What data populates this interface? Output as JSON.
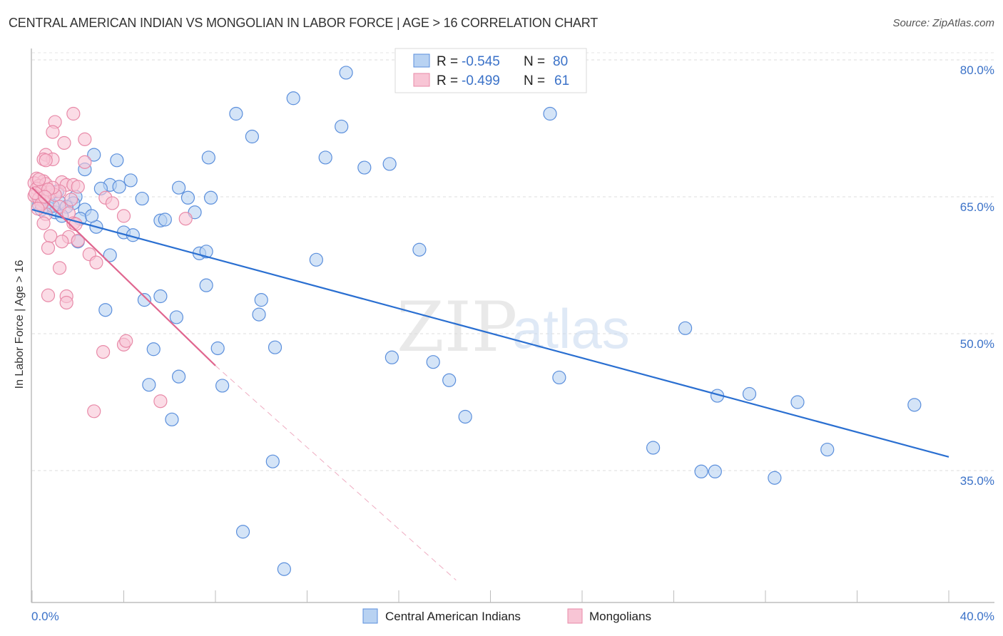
{
  "title": "CENTRAL AMERICAN INDIAN VS MONGOLIAN IN LABOR FORCE | AGE > 16 CORRELATION CHART",
  "source": "Source: ZipAtlas.com",
  "watermark": {
    "zip": "ZIP",
    "atlas": "atlas"
  },
  "colors": {
    "blue_fill": "#b8d2f2",
    "blue_stroke": "#5b8fdc",
    "blue_line": "#2a6fd1",
    "pink_fill": "#f8c5d5",
    "pink_stroke": "#e88aa8",
    "pink_line": "#e0668f",
    "tick": "#3b72c8"
  },
  "stats_legend": {
    "rows": [
      {
        "r_label": "R =",
        "r_value": "-0.545",
        "n_label": "N =",
        "n_value": "80"
      },
      {
        "r_label": "R =",
        "r_value": "-0.499",
        "n_label": "N =",
        "n_value": "61"
      }
    ]
  },
  "chart_data": {
    "type": "scatter",
    "title": "CENTRAL AMERICAN INDIAN VS MONGOLIAN IN LABOR FORCE | AGE > 16 CORRELATION CHART",
    "xlabel": "",
    "ylabel": "In Labor Force | Age > 16",
    "xlim": [
      0,
      40
    ],
    "ylim": [
      23,
      82
    ],
    "x_tick_labels": [
      "0.0%",
      "40.0%"
    ],
    "y_ticks": [
      35,
      50,
      65,
      80
    ],
    "y_tick_labels": [
      "35.0%",
      "50.0%",
      "65.0%",
      "80.0%"
    ],
    "grid": true,
    "legend_position": "bottom-center",
    "series": [
      {
        "name": "Central American Indians",
        "R": -0.545,
        "N": 80,
        "trend": {
          "x0": 0,
          "y0": 63.6,
          "x1": 40,
          "y1": 36.5
        },
        "points": [
          [
            13.7,
            78.6
          ],
          [
            11.4,
            75.8
          ],
          [
            8.9,
            74.1
          ],
          [
            9.6,
            71.6
          ],
          [
            13.5,
            72.7
          ],
          [
            22.6,
            74.1
          ],
          [
            7.7,
            69.3
          ],
          [
            12.8,
            69.3
          ],
          [
            14.5,
            68.2
          ],
          [
            15.6,
            68.6
          ],
          [
            2.7,
            69.6
          ],
          [
            3.7,
            69.0
          ],
          [
            2.3,
            68.0
          ],
          [
            4.3,
            66.8
          ],
          [
            3.4,
            66.3
          ],
          [
            3.8,
            66.1
          ],
          [
            3.0,
            65.9
          ],
          [
            6.4,
            66.0
          ],
          [
            1.9,
            65.0
          ],
          [
            4.8,
            64.8
          ],
          [
            6.8,
            64.9
          ],
          [
            7.8,
            64.9
          ],
          [
            1.2,
            64.4
          ],
          [
            1.8,
            64.3
          ],
          [
            0.3,
            64.1
          ],
          [
            0.7,
            63.8
          ],
          [
            1.5,
            63.9
          ],
          [
            2.3,
            63.6
          ],
          [
            1.0,
            63.3
          ],
          [
            7.1,
            63.3
          ],
          [
            1.3,
            62.9
          ],
          [
            2.1,
            62.6
          ],
          [
            5.6,
            62.4
          ],
          [
            5.8,
            62.5
          ],
          [
            2.8,
            61.7
          ],
          [
            4.0,
            61.1
          ],
          [
            4.4,
            60.8
          ],
          [
            2.0,
            60.1
          ],
          [
            7.3,
            58.8
          ],
          [
            7.6,
            59.0
          ],
          [
            3.4,
            58.6
          ],
          [
            16.9,
            59.2
          ],
          [
            12.4,
            58.1
          ],
          [
            7.6,
            55.3
          ],
          [
            4.9,
            53.7
          ],
          [
            5.6,
            54.1
          ],
          [
            10.0,
            53.7
          ],
          [
            9.9,
            52.1
          ],
          [
            3.2,
            52.6
          ],
          [
            6.3,
            51.8
          ],
          [
            28.5,
            50.6
          ],
          [
            8.1,
            48.4
          ],
          [
            5.3,
            48.3
          ],
          [
            10.6,
            48.5
          ],
          [
            15.7,
            47.4
          ],
          [
            17.5,
            46.9
          ],
          [
            6.4,
            45.3
          ],
          [
            5.1,
            44.4
          ],
          [
            8.3,
            44.3
          ],
          [
            18.2,
            44.9
          ],
          [
            23.0,
            45.2
          ],
          [
            29.9,
            43.2
          ],
          [
            31.3,
            43.4
          ],
          [
            33.4,
            42.5
          ],
          [
            38.5,
            42.2
          ],
          [
            6.1,
            40.6
          ],
          [
            18.9,
            40.9
          ],
          [
            27.1,
            37.5
          ],
          [
            34.7,
            37.3
          ],
          [
            10.5,
            36.0
          ],
          [
            29.2,
            34.9
          ],
          [
            29.8,
            34.9
          ],
          [
            32.4,
            34.2
          ],
          [
            9.2,
            28.3
          ],
          [
            11.0,
            24.2
          ],
          [
            0.5,
            64.9
          ],
          [
            1.1,
            65.6
          ],
          [
            0.4,
            63.6
          ],
          [
            2.6,
            62.9
          ],
          [
            0.9,
            64.0
          ]
        ]
      },
      {
        "name": "Mongolians",
        "R": -0.499,
        "N": 61,
        "trend": {
          "x0": 0,
          "y0": 66.0,
          "x1": 8.0,
          "y1": 46.5
        },
        "trend_dashed_to": {
          "x": 18.5,
          "y": 23.0
        },
        "points": [
          [
            1.8,
            74.1
          ],
          [
            1.0,
            73.2
          ],
          [
            0.9,
            72.1
          ],
          [
            1.4,
            70.9
          ],
          [
            2.3,
            71.3
          ],
          [
            0.6,
            69.6
          ],
          [
            0.9,
            69.1
          ],
          [
            0.5,
            69.1
          ],
          [
            0.6,
            69.0
          ],
          [
            2.3,
            68.8
          ],
          [
            0.2,
            67.0
          ],
          [
            0.5,
            66.7
          ],
          [
            0.1,
            66.5
          ],
          [
            0.3,
            66.2
          ],
          [
            0.6,
            66.4
          ],
          [
            1.3,
            66.6
          ],
          [
            1.5,
            66.3
          ],
          [
            1.8,
            66.3
          ],
          [
            2.0,
            66.1
          ],
          [
            0.2,
            65.9
          ],
          [
            0.4,
            65.6
          ],
          [
            0.8,
            65.5
          ],
          [
            1.2,
            65.6
          ],
          [
            1.0,
            65.2
          ],
          [
            0.1,
            65.1
          ],
          [
            0.3,
            64.8
          ],
          [
            0.5,
            64.5
          ],
          [
            1.2,
            63.9
          ],
          [
            0.6,
            63.1
          ],
          [
            1.6,
            63.2
          ],
          [
            3.2,
            64.9
          ],
          [
            3.5,
            64.3
          ],
          [
            4.0,
            62.9
          ],
          [
            6.7,
            62.6
          ],
          [
            0.5,
            62.1
          ],
          [
            1.8,
            62.1
          ],
          [
            0.8,
            60.7
          ],
          [
            1.6,
            60.6
          ],
          [
            1.3,
            60.1
          ],
          [
            2.5,
            58.7
          ],
          [
            2.8,
            57.8
          ],
          [
            0.7,
            59.4
          ],
          [
            1.2,
            57.2
          ],
          [
            0.7,
            54.2
          ],
          [
            1.5,
            54.1
          ],
          [
            1.5,
            53.4
          ],
          [
            4.0,
            48.8
          ],
          [
            4.1,
            49.2
          ],
          [
            3.1,
            48.0
          ],
          [
            5.6,
            42.6
          ],
          [
            2.7,
            41.5
          ],
          [
            0.3,
            66.9
          ],
          [
            0.15,
            65.4
          ],
          [
            0.9,
            66.0
          ],
          [
            0.4,
            64.2
          ],
          [
            0.7,
            65.8
          ],
          [
            1.9,
            62.0
          ],
          [
            0.25,
            63.7
          ],
          [
            2.0,
            60.2
          ],
          [
            1.7,
            64.7
          ],
          [
            0.55,
            65.0
          ]
        ]
      }
    ]
  },
  "bottom_legend": {
    "items": [
      {
        "label": "Central American Indians"
      },
      {
        "label": "Mongolians"
      }
    ]
  }
}
